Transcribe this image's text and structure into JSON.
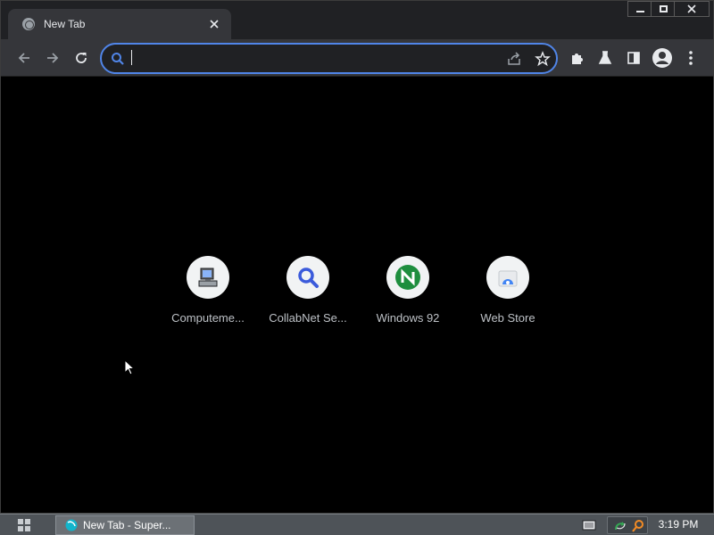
{
  "browser": {
    "tab": {
      "title": "New Tab",
      "favicon": "globe-icon",
      "close_icon": "close-icon"
    },
    "window_controls": [
      "minimize-icon",
      "maximize-icon",
      "close-icon"
    ],
    "toolbar": {
      "nav": [
        "back-arrow-icon",
        "forward-arrow-icon",
        "reload-icon"
      ],
      "omnibox": {
        "value": "",
        "placeholder": "",
        "left_icon": "search-icon",
        "right_icons": [
          "share-icon",
          "star-icon"
        ]
      },
      "actions": [
        "extensions-icon",
        "labs-flask-icon",
        "side-panel-icon",
        "profile-avatar-icon",
        "more-menu-icon"
      ]
    }
  },
  "new_tab": {
    "shortcuts": [
      {
        "label": "Computeme...",
        "icon": "computer-icon"
      },
      {
        "label": "CollabNet Se...",
        "icon": "magnifier-icon"
      },
      {
        "label": "Windows 92",
        "icon": "n-logo-icon"
      },
      {
        "label": "Web Store",
        "icon": "web-store-icon"
      }
    ]
  },
  "taskbar": {
    "start_icon": "start-grid-icon",
    "task": {
      "label": "New Tab - Super...",
      "icon": "browser-app-icon"
    },
    "tray_icons": [
      "keyboard-icon",
      "network-icon",
      "search-tray-icon"
    ],
    "clock": "3:19 PM"
  },
  "colors": {
    "accent": "#5085e8",
    "toolbar": "#35363a",
    "tabstrip": "#202124",
    "taskbar": "#4e5358"
  }
}
